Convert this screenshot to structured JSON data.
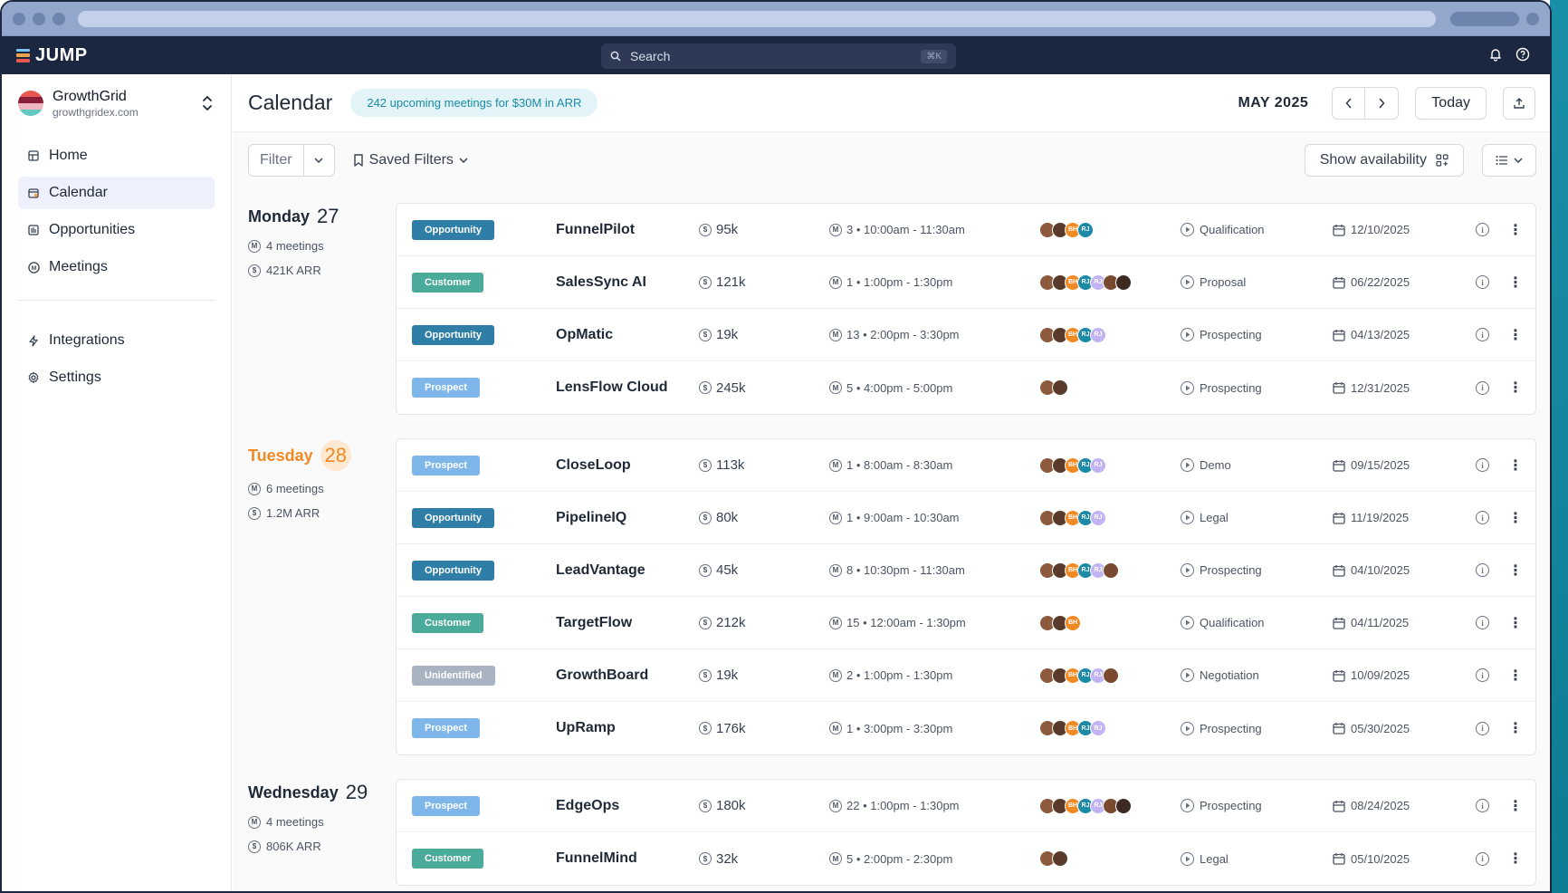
{
  "app": {
    "name": "JUMP"
  },
  "search": {
    "placeholder": "Search",
    "shortcut": "⌘K"
  },
  "workspace": {
    "name": "GrowthGrid",
    "domain": "growthgridex.com"
  },
  "nav": {
    "items": [
      {
        "label": "Home",
        "icon": "home-icon"
      },
      {
        "label": "Calendar",
        "icon": "calendar-icon",
        "active": true
      },
      {
        "label": "Opportunities",
        "icon": "opportunities-icon"
      },
      {
        "label": "Meetings",
        "icon": "meetings-icon"
      }
    ],
    "secondary": [
      {
        "label": "Integrations",
        "icon": "bolt-icon"
      },
      {
        "label": "Settings",
        "icon": "gear-icon"
      }
    ]
  },
  "header": {
    "title": "Calendar",
    "banner": "242 upcoming meetings for $30M in ARR",
    "month": "MAY 2025",
    "today_label": "Today"
  },
  "toolbar": {
    "filter_label": "Filter",
    "saved_filters_label": "Saved Filters",
    "availability_label": "Show availability"
  },
  "colors": {
    "Opportunity": "#2f7ea7",
    "Customer": "#4aab9a",
    "Prospect": "#7fb7ea",
    "Unidentified": "#a9b3c1"
  },
  "days": [
    {
      "name": "Monday",
      "num": "27",
      "today": false,
      "meetings": "4 meetings",
      "arr": "421K ARR",
      "rows": [
        {
          "type": "Opportunity",
          "company": "FunnelPilot",
          "arr": "95k",
          "meeting": "3 • 10:00am - 11:30am",
          "avatars": [
            "p",
            "p",
            "BH",
            "RJ"
          ],
          "stage": "Qualification",
          "date": "12/10/2025"
        },
        {
          "type": "Customer",
          "company": "SalesSync AI",
          "arr": "121k",
          "meeting": "1 • 1:00pm - 1:30pm",
          "avatars": [
            "p",
            "p",
            "BH",
            "RJ",
            "RJ",
            "p",
            "p"
          ],
          "stage": "Proposal",
          "date": "06/22/2025"
        },
        {
          "type": "Opportunity",
          "company": "OpMatic",
          "arr": "19k",
          "meeting": "13 • 2:00pm - 3:30pm",
          "avatars": [
            "p",
            "p",
            "BH",
            "RJ",
            "RJ"
          ],
          "stage": "Prospecting",
          "date": "04/13/2025"
        },
        {
          "type": "Prospect",
          "company": "LensFlow Cloud",
          "arr": "245k",
          "meeting": "5 • 4:00pm - 5:00pm",
          "avatars": [
            "p",
            "p"
          ],
          "stage": "Prospecting",
          "date": "12/31/2025"
        }
      ]
    },
    {
      "name": "Tuesday",
      "num": "28",
      "today": true,
      "meetings": "6 meetings",
      "arr": "1.2M ARR",
      "rows": [
        {
          "type": "Prospect",
          "company": "CloseLoop",
          "arr": "113k",
          "meeting": "1 • 8:00am - 8:30am",
          "avatars": [
            "p",
            "p",
            "BH",
            "RJ",
            "RJ"
          ],
          "stage": "Demo",
          "date": "09/15/2025"
        },
        {
          "type": "Opportunity",
          "company": "PipelineIQ",
          "arr": "80k",
          "meeting": "1 • 9:00am - 10:30am",
          "avatars": [
            "p",
            "p",
            "BH",
            "RJ",
            "RJ"
          ],
          "stage": "Legal",
          "date": "11/19/2025"
        },
        {
          "type": "Opportunity",
          "company": "LeadVantage",
          "arr": "45k",
          "meeting": "8 • 10:30pm - 11:30am",
          "avatars": [
            "p",
            "p",
            "BH",
            "RJ",
            "RJ",
            "p"
          ],
          "stage": "Prospecting",
          "date": "04/10/2025"
        },
        {
          "type": "Customer",
          "company": "TargetFlow",
          "arr": "212k",
          "meeting": "15 • 12:00am - 1:30pm",
          "avatars": [
            "p",
            "p",
            "BH"
          ],
          "stage": "Qualification",
          "date": "04/11/2025"
        },
        {
          "type": "Unidentified",
          "company": "GrowthBoard",
          "arr": "19k",
          "meeting": "2 • 1:00pm - 1:30pm",
          "avatars": [
            "p",
            "p",
            "BH",
            "RJ",
            "RJ",
            "p"
          ],
          "stage": "Negotiation",
          "date": "10/09/2025"
        },
        {
          "type": "Prospect",
          "company": "UpRamp",
          "arr": "176k",
          "meeting": "1 • 3:00pm - 3:30pm",
          "avatars": [
            "p",
            "p",
            "BH",
            "RJ",
            "RJ"
          ],
          "stage": "Prospecting",
          "date": "05/30/2025"
        }
      ]
    },
    {
      "name": "Wednesday",
      "num": "29",
      "today": false,
      "meetings": "4 meetings",
      "arr": "806K ARR",
      "rows": [
        {
          "type": "Prospect",
          "company": "EdgeOps",
          "arr": "180k",
          "meeting": "22 • 1:00pm - 1:30pm",
          "avatars": [
            "p",
            "p",
            "BH",
            "RJ",
            "RJ",
            "p",
            "p"
          ],
          "stage": "Prospecting",
          "date": "08/24/2025"
        },
        {
          "type": "Customer",
          "company": "FunnelMind",
          "arr": "32k",
          "meeting": "5 • 2:00pm - 2:30pm",
          "avatars": [
            "p",
            "p"
          ],
          "stage": "Legal",
          "date": "05/10/2025"
        }
      ]
    }
  ]
}
